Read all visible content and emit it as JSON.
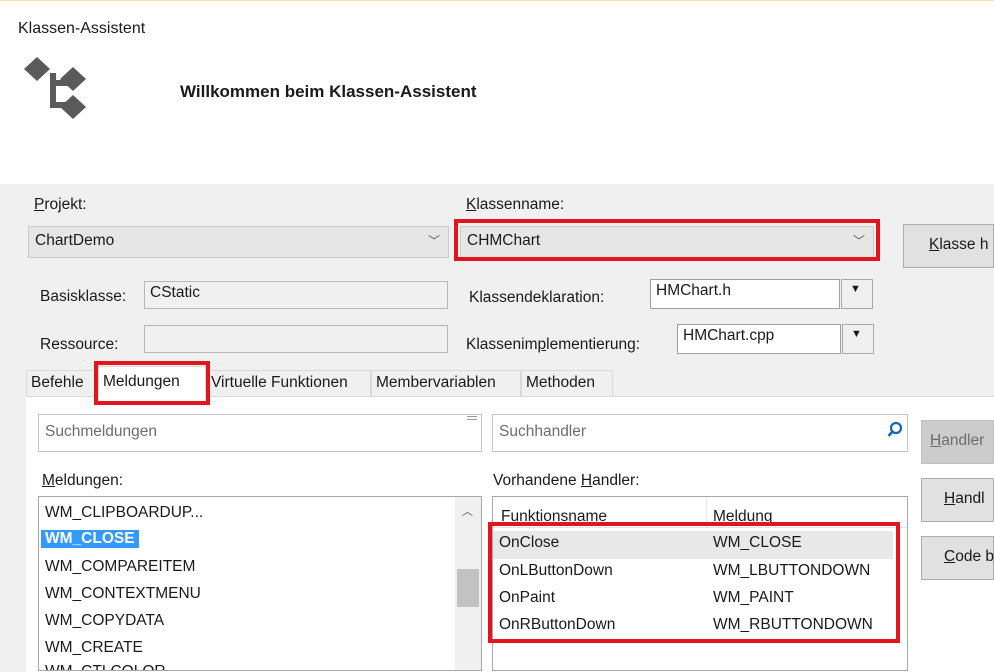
{
  "window": {
    "title": "Klassen-Assistent"
  },
  "header": {
    "welcome": "Willkommen beim Klassen-Assistent",
    "logo_icon": "class-wizard-logo-icon"
  },
  "project": {
    "label_u": "P",
    "label_rest": "rojekt:",
    "value": "ChartDemo"
  },
  "classname": {
    "label_u": "K",
    "label_rest": "lassenname:",
    "value": "CHMChart"
  },
  "add_class_button": {
    "label_u": "K",
    "label_rest": "lasse h"
  },
  "base_class": {
    "label": "Basisklasse:",
    "value": "CStatic"
  },
  "resource": {
    "label": "Ressource:",
    "value": ""
  },
  "class_declaration": {
    "label": "Klassendeklaration:",
    "value": "HMChart.h"
  },
  "class_implementation": {
    "label_pre": "Klassenim",
    "label_u": "p",
    "label_post": "lementierung:",
    "value": "HMChart.cpp"
  },
  "tabs": [
    {
      "label": "Befehle"
    },
    {
      "label": "Meldungen"
    },
    {
      "label": "Virtuelle Funktionen"
    },
    {
      "label": "Membervariablen"
    },
    {
      "label": "Methoden"
    }
  ],
  "messages": {
    "search_placeholder": "Suchmeldungen",
    "label_u": "M",
    "label_rest": "eldungen:",
    "items": [
      "WM_CLIPBOARDUP...",
      "WM_CLOSE",
      "WM_COMPAREITEM",
      "WM_CONTEXTMENU",
      "WM_COPYDATA",
      "WM_CREATE",
      "WM_CTLCOLOR"
    ],
    "selected": "WM_CLOSE"
  },
  "handlers": {
    "search_placeholder": "Suchhandler",
    "label_pre": "Vorhandene ",
    "label_u": "H",
    "label_post": "andler:",
    "columns": [
      "Funktionsname",
      "Meldung"
    ],
    "rows": [
      {
        "function": "OnClose",
        "message": "WM_CLOSE"
      },
      {
        "function": "OnLButtonDown",
        "message": "WM_LBUTTONDOWN"
      },
      {
        "function": "OnPaint",
        "message": "WM_PAINT"
      },
      {
        "function": "OnRButtonDown",
        "message": "WM_RBUTTONDOWN"
      }
    ]
  },
  "right_buttons": {
    "add_handler": {
      "u": "H",
      "rest": "andler"
    },
    "delete_handler": {
      "u": "H",
      "rest": "andl"
    },
    "edit_code": {
      "u": "C",
      "rest": "ode b"
    }
  },
  "colors": {
    "highlight": "#e2141e",
    "selection": "#3399ff"
  }
}
